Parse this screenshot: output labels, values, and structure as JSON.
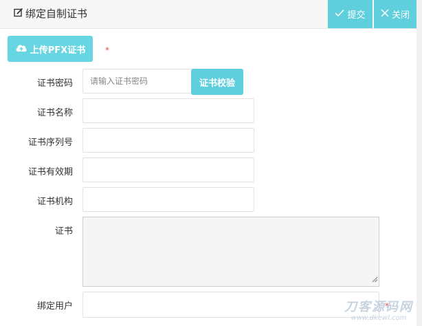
{
  "dialog": {
    "title": "绑定自制证书"
  },
  "header": {
    "submit_label": "提交",
    "close_label": "关闭"
  },
  "upload": {
    "label": "上传PFX证书",
    "required_mark": "*"
  },
  "form": {
    "password_label": "证书密码",
    "password_placeholder": "请输入证书密码",
    "verify_label": "证书校验",
    "name_label": "证书名称",
    "serial_label": "证书序列号",
    "validity_label": "证书有效期",
    "org_label": "证书机构",
    "cert_label": "证书",
    "user_label": "绑定用户",
    "user_required_mark": "*"
  },
  "watermark": {
    "main": "刀客源码网",
    "sub": "www.dkewl.com"
  },
  "colors": {
    "accent": "#5fcfdd",
    "upload": "#68d6e2",
    "required": "#e05050"
  },
  "icons": {
    "title": "edit-icon",
    "submit": "check-icon",
    "close": "close-icon",
    "upload": "cloud-upload-icon"
  }
}
